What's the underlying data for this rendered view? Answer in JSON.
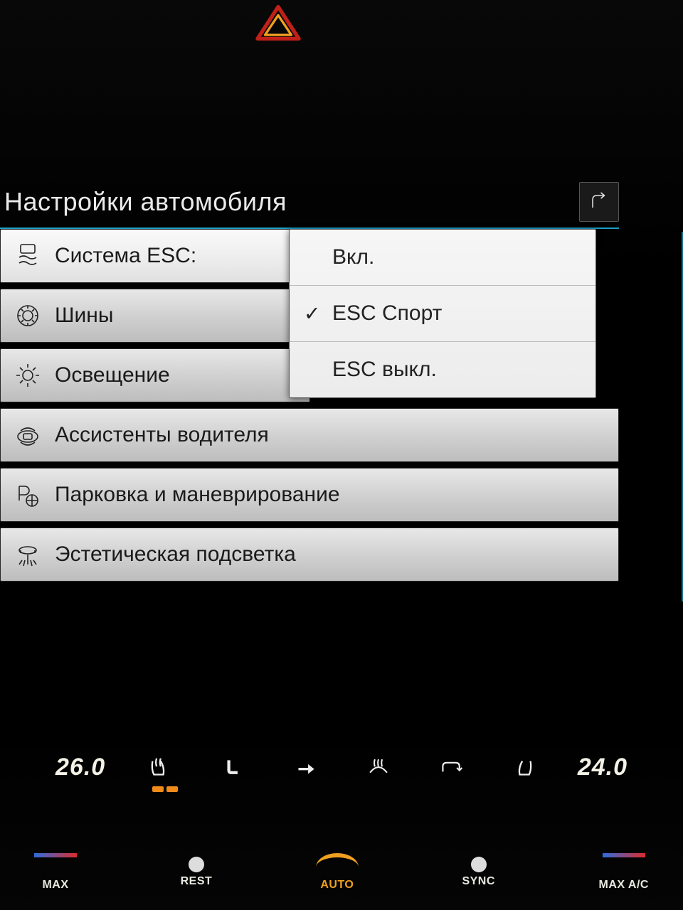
{
  "header": {
    "title": "Настройки автомобиля"
  },
  "menu": {
    "items": [
      {
        "label": "Система ESC:",
        "icon": "esc",
        "selected": true
      },
      {
        "label": "Шины",
        "icon": "tire",
        "selected": false
      },
      {
        "label": "Освещение",
        "icon": "light",
        "selected": false
      },
      {
        "label": "Ассистенты водителя",
        "icon": "assist",
        "selected": false
      },
      {
        "label": "Парковка и маневрирование",
        "icon": "park",
        "selected": false
      },
      {
        "label": "Эстетическая подсветка",
        "icon": "ambient",
        "selected": false
      }
    ]
  },
  "esc_popup": {
    "options": [
      {
        "label": "Вкл.",
        "checked": false
      },
      {
        "label": "ESC Спорт",
        "checked": true
      },
      {
        "label": "ESC выкл.",
        "checked": false
      }
    ]
  },
  "climate": {
    "temp_left": "26.0",
    "temp_right": "24.0",
    "labels": {
      "max_defrost": "MAX",
      "rest": "REST",
      "auto": "AUTO",
      "sync": "SYNC",
      "max_ac": "MAX A/C"
    }
  }
}
